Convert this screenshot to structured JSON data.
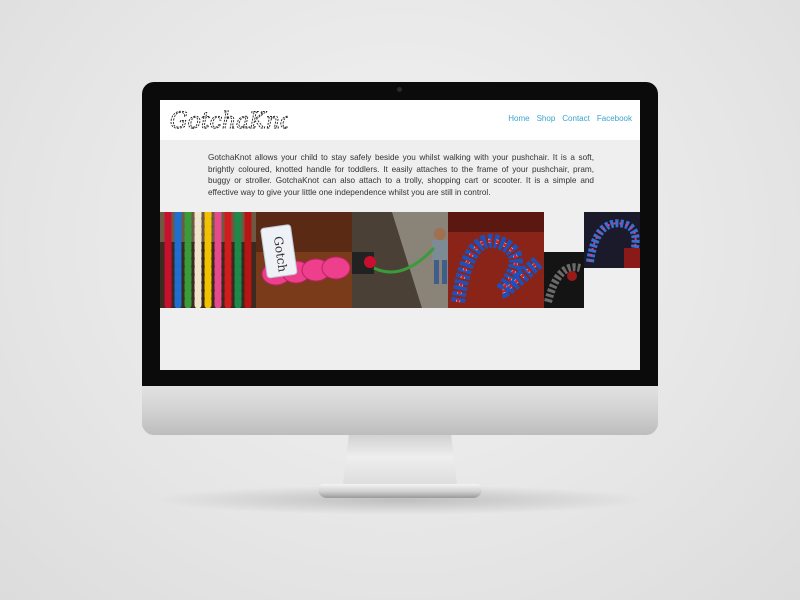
{
  "site": {
    "logo_text": "GotchaKnot",
    "nav": [
      {
        "label": "Home"
      },
      {
        "label": "Shop"
      },
      {
        "label": "Contact"
      },
      {
        "label": "Facebook"
      }
    ],
    "intro": "GotchaKnot allows your child to stay safely beside you whilst walking with your pushchair. It is a soft, brightly coloured, knotted handle for toddlers. It easily attaches to the frame of your pushchair, pram, buggy or stroller. GotchaKnot can also attach to a trolly, shopping cart or scooter. It is a simple and effective way to give your little one independence whilst you are still in control.",
    "gallery": [
      {
        "name": "colourful-knots-photo"
      },
      {
        "name": "pink-knot-tag-photo",
        "tag_text": "Gotch"
      },
      {
        "name": "toddler-walking-photo"
      },
      {
        "name": "multicolour-knot-photo"
      },
      {
        "name": "dark-knot-photo"
      }
    ]
  },
  "colors": {
    "nav_link": "#3aa3cf",
    "content_bg": "#efefef",
    "bezel": "#0b0b0b"
  }
}
